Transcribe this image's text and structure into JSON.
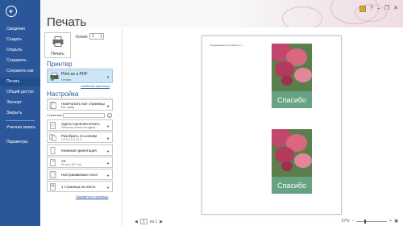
{
  "nav": {
    "items": [
      "Сведения",
      "Создать",
      "Открыть",
      "Сохранить",
      "Сохранить как",
      "Печать",
      "Общий доступ",
      "Экспорт",
      "Закрыть"
    ],
    "account": "Учетная запись",
    "options": "Параметры",
    "active_index": 5
  },
  "page_title": "Печать",
  "print_button": "Печать",
  "copies": {
    "label": "Копии:",
    "value": "1"
  },
  "printer": {
    "section": "Принтер",
    "name": "Print as a PDF",
    "status": "Готово",
    "properties_link": "Свойства принтера"
  },
  "settings": {
    "section": "Настройка",
    "items": [
      {
        "main": "Напечатать все страницы",
        "sub": "Все сразу",
        "icon": "pages-icon"
      },
      {
        "main": "Односторонняя печать",
        "sub": "Печатать только на одной...",
        "icon": "one-sided-icon"
      },
      {
        "main": "Разобрать по копиям",
        "sub": "1,2,3    1,2,3    1,2,3",
        "icon": "collate-icon"
      },
      {
        "main": "Книжная ориентация",
        "sub": "",
        "icon": "orientation-icon"
      },
      {
        "main": "A4",
        "sub": "21 см x 29,7 см",
        "icon": "paper-size-icon"
      },
      {
        "main": "Настраиваемые поля",
        "sub": "",
        "icon": "margins-icon"
      },
      {
        "main": "1 страница на листе",
        "sub": "",
        "icon": "pages-per-sheet-icon"
      }
    ],
    "pages_label": "Страницы:",
    "page_setup_link": "Параметры страницы"
  },
  "preview": {
    "header_text": "Поздравление для Мамы в с...",
    "card_text": "Спасибо",
    "card_count": 2
  },
  "pager": {
    "current": "1",
    "of": "из 1"
  },
  "zoom": {
    "value": "37%"
  },
  "topbar": {
    "help": "?",
    "minimize": "–",
    "restore": "❐",
    "close": "✕"
  },
  "colors": {
    "nav_bg": "#2b579a",
    "accent": "#2b579a",
    "printer_highlight": "#cde6f7",
    "card_band": "#6aa88d"
  }
}
